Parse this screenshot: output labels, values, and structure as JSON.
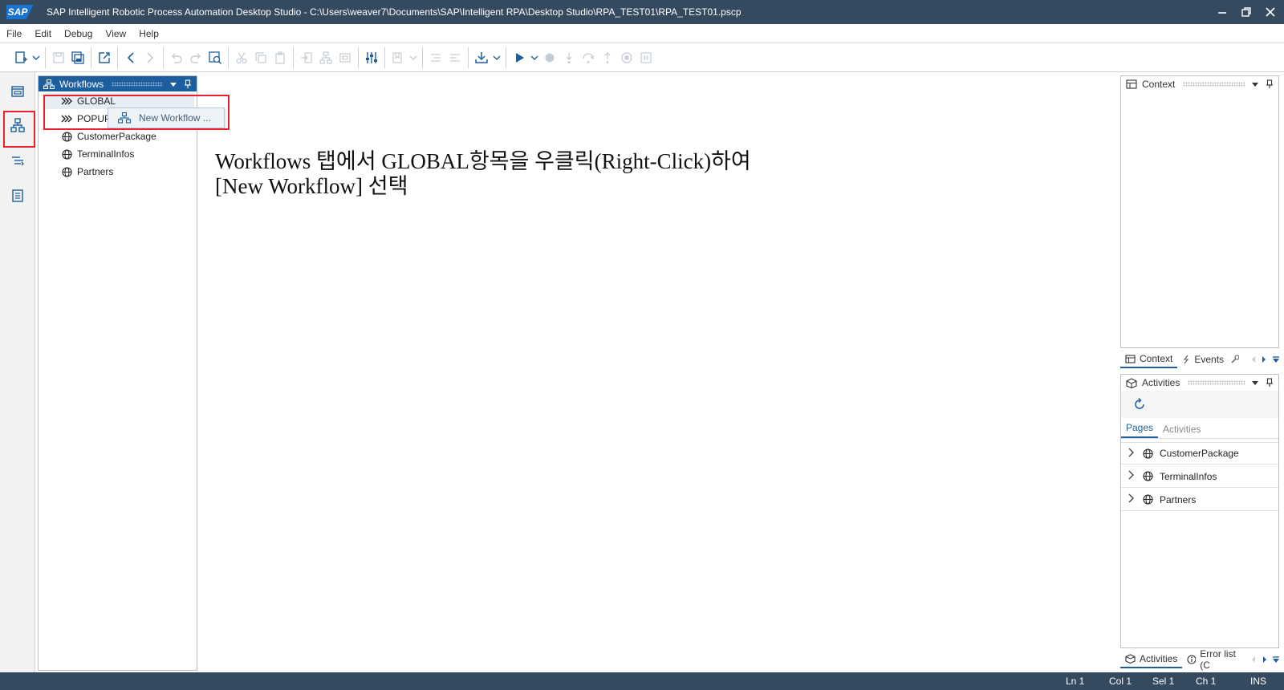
{
  "window": {
    "logo": "SAP",
    "title": "SAP Intelligent Robotic Process Automation Desktop Studio - C:\\Users\\weaver7\\Documents\\SAP\\Intelligent RPA\\Desktop Studio\\RPA_TEST01\\RPA_TEST01.pscp"
  },
  "menu": [
    "File",
    "Edit",
    "Debug",
    "View",
    "Help"
  ],
  "workflows_panel": {
    "title": "Workflows",
    "items": [
      {
        "label": "GLOBAL",
        "icon": "chevrons-right-icon"
      },
      {
        "label": "POPUP",
        "icon": "chevrons-right-icon"
      },
      {
        "label": "CustomerPackage",
        "icon": "globe-icon"
      },
      {
        "label": "TerminalInfos",
        "icon": "globe-icon"
      },
      {
        "label": "Partners",
        "icon": "globe-icon"
      }
    ]
  },
  "context_menu": {
    "item_label": "New Workflow ..."
  },
  "annotation": {
    "line1": "Workflows 탭에서 GLOBAL항목을 우클릭(Right-Click)하여",
    "line2": "[New Workflow] 선택"
  },
  "right_top_panel": {
    "title": "Context",
    "tabs": [
      "Context",
      "Events"
    ]
  },
  "right_bottom_panel": {
    "title": "Activities",
    "subtabs": [
      "Pages",
      "Activities"
    ],
    "active_subtab": "Pages",
    "pages": [
      "CustomerPackage",
      "TerminalInfos",
      "Partners"
    ],
    "tabs": [
      "Activities",
      "Error list (C"
    ]
  },
  "status_bar": {
    "ln": "Ln 1",
    "col": "Col 1",
    "sel": "Sel 1",
    "ch": "Ch 1",
    "mode": "INS"
  },
  "colors": {
    "titlebar": "#354a5f",
    "panel_header": "#1d5e9f",
    "highlight": "#e8222b",
    "accent": "#1873d1"
  }
}
